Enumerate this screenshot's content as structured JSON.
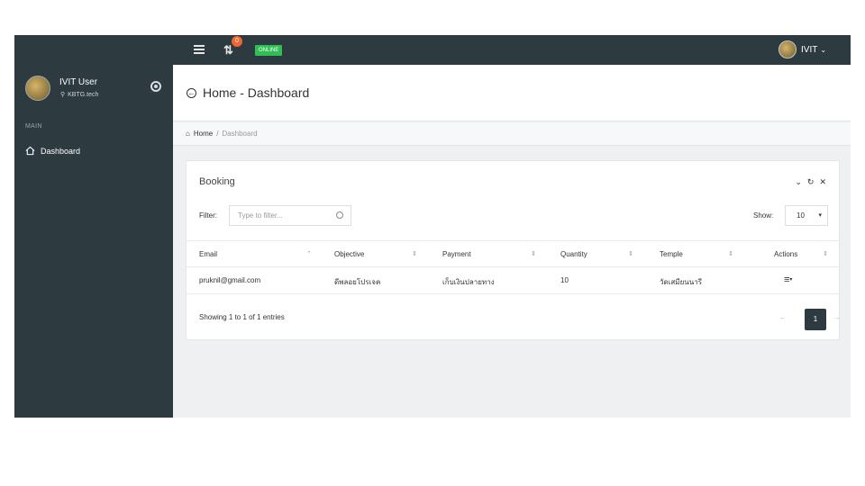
{
  "topbar": {
    "notification_count": "0",
    "status_badge": "ONLINE",
    "user_label": "IVIT",
    "user_caret": "⌄"
  },
  "sidebar": {
    "user_name": "IVIT User",
    "user_location": "KBTG.tech",
    "section_label": "MAIN",
    "items": [
      {
        "label": "Dashboard",
        "icon": "home-outline-icon"
      }
    ]
  },
  "header": {
    "title": "Home - Dashboard"
  },
  "breadcrumb": {
    "home": "Home",
    "separator": "/",
    "current": "Dashboard"
  },
  "panel": {
    "title": "Booking",
    "tools": {
      "collapse": "⌄",
      "refresh": "↻",
      "close": "✕"
    },
    "filter_label": "Filter:",
    "filter_placeholder": "Type to filter...",
    "show_label": "Show:",
    "show_value": "10",
    "columns": [
      "Email",
      "Objective",
      "Payment",
      "Quantity",
      "Temple",
      "Actions"
    ],
    "rows": [
      {
        "email": "pruknil@gmail.com",
        "objective": "ดีพลอยโปรเจค",
        "payment": "เก็บเงินปลายทาง",
        "quantity": "10",
        "temple": "วัดเสมียนนารี"
      }
    ],
    "info": "Showing 1 to 1 of 1 entries",
    "pagination": {
      "prev": "←",
      "current": "1",
      "next": "→"
    }
  },
  "colors": {
    "navbar": "#2d3a40",
    "online": "#2fbf55",
    "badge": "#f0662e"
  }
}
